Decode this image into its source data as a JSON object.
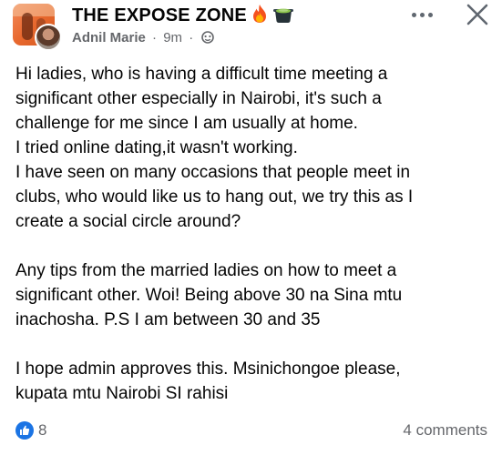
{
  "post": {
    "group_name": "THE EXPOSE ZONE",
    "author": "Adnil Marie",
    "time": "9m",
    "separator": "·",
    "paragraphs": [
      [
        "Hi ladies, who is having a difficult time meeting a",
        "significant other especially in Nairobi, it's such a",
        "challenge for me since I am usually at home.",
        "I tried online dating,it wasn't working.",
        "I have seen on many occasions that people meet in",
        "clubs, who would like us to hang out, we try this as I",
        "create a social circle around?"
      ],
      [
        "Any tips from the married ladies on how to meet a",
        "significant other. Woi! Being above 30 na Sina mtu",
        "inachosha. P.S I am between 30 and 35"
      ],
      [
        "I hope admin approves this. Msinichongoe please,",
        "kupata mtu Nairobi SI rahisi"
      ]
    ],
    "reaction_count": "8",
    "comments_label": "4 comments"
  },
  "icons": {
    "group_avatar": "group-avatar-image",
    "user_avatar": "user-avatar-image",
    "emoji_1": "fire-icon",
    "emoji_2": "cooking-pot-icon",
    "audience": "friends-globe-icon",
    "more": "more-options-icon",
    "close": "close-icon",
    "reaction": "like-icon"
  },
  "colors": {
    "text": "#050505",
    "secondary_text": "#65676b",
    "like_blue": "#1b74e4",
    "background": "#ffffff"
  }
}
